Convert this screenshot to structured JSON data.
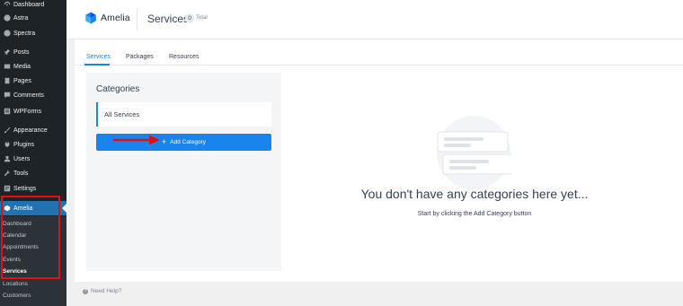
{
  "sidebar": {
    "items": [
      {
        "label": "Dashboard",
        "icon": "dashboard-icon"
      },
      {
        "label": "Astra",
        "icon": "astra-icon"
      },
      {
        "label": "Spectra",
        "icon": "spectra-icon"
      },
      {
        "label": "Posts",
        "icon": "pin-icon"
      },
      {
        "label": "Media",
        "icon": "media-icon"
      },
      {
        "label": "Pages",
        "icon": "pages-icon"
      },
      {
        "label": "Comments",
        "icon": "comments-icon"
      },
      {
        "label": "WPForms",
        "icon": "wpforms-icon"
      },
      {
        "label": "Appearance",
        "icon": "brush-icon"
      },
      {
        "label": "Plugins",
        "icon": "plugins-icon"
      },
      {
        "label": "Users",
        "icon": "users-icon"
      },
      {
        "label": "Tools",
        "icon": "wrench-icon"
      },
      {
        "label": "Settings",
        "icon": "settings-icon"
      },
      {
        "label": "Amelia",
        "icon": "amelia-icon"
      }
    ],
    "submenu": [
      "Dashboard",
      "Calendar",
      "Appointments",
      "Events",
      "Services",
      "Locations",
      "Customers"
    ],
    "active_submenu": "Services"
  },
  "header": {
    "logo_text": "Amelia",
    "page_title": "Services",
    "count": "0",
    "count_label": "Total"
  },
  "tabs": [
    "Services",
    "Packages",
    "Resources"
  ],
  "categories": {
    "title": "Categories",
    "all_services": "All Services",
    "add_button": "Add Category"
  },
  "empty_state": {
    "title": "You don't have any categories here yet...",
    "subtitle": "Start by clicking the Add Category button"
  },
  "footer": {
    "help_label": "Need Help?"
  },
  "colors": {
    "accent": "#1a84ee",
    "wp_sidebar": "#1d2327",
    "wp_active": "#2271b1",
    "annotation_red": "#e01016"
  }
}
